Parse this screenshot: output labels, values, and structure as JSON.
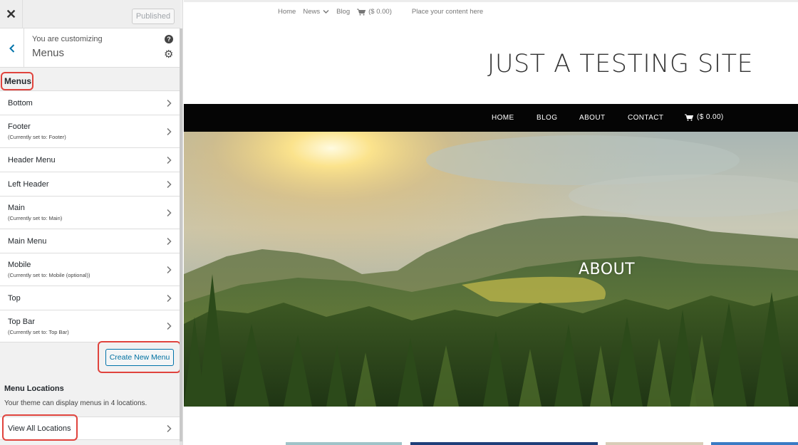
{
  "sidebar": {
    "close_icon": "close-icon",
    "publish_label": "Published",
    "customizing_label": "You are customizing",
    "section_title": "Menus",
    "menus_heading": "Menus",
    "menu_items": [
      {
        "label": "Bottom",
        "sub": ""
      },
      {
        "label": "Footer",
        "sub": "(Currently set to: Footer)"
      },
      {
        "label": "Header Menu",
        "sub": ""
      },
      {
        "label": "Left Header",
        "sub": ""
      },
      {
        "label": "Main",
        "sub": "(Currently set to: Main)"
      },
      {
        "label": "Main Menu",
        "sub": ""
      },
      {
        "label": "Mobile",
        "sub": "(Currently set to: Mobile (optional))"
      },
      {
        "label": "Top",
        "sub": ""
      },
      {
        "label": "Top Bar",
        "sub": "(Currently set to: Top Bar)"
      }
    ],
    "create_button": "Create New Menu",
    "locations_heading": "Menu Locations",
    "locations_desc": "Your theme can display menus in 4 locations.",
    "view_all": "View All Locations"
  },
  "preview": {
    "topnav": {
      "home": "Home",
      "news": "News",
      "blog": "Blog",
      "cart": "($ 0.00)",
      "placeholder": "Place your content here"
    },
    "site_title": "JUST A TESTING SITE",
    "mainnav": {
      "home": "HOME",
      "blog": "BLOG",
      "about": "ABOUT",
      "contact": "CONTACT",
      "cart": "($ 0.00)"
    },
    "hero_title": "ABOUT"
  },
  "colors": {
    "accent": "#0073aa",
    "highlight": "#e0433d",
    "nav_bg": "#050505"
  }
}
